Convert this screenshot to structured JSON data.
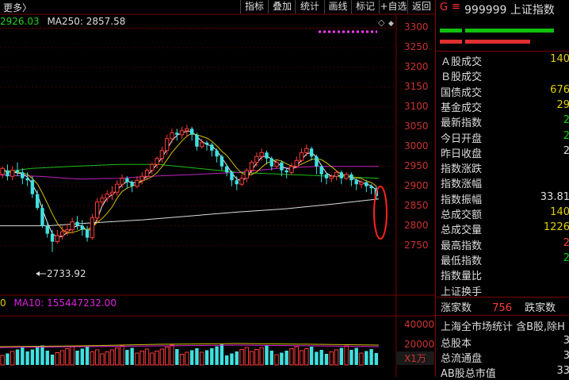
{
  "toolbar": {
    "more_label": "更多〉",
    "buttons": [
      "指标",
      "叠加",
      "统计",
      "画线",
      "标记",
      "+自选",
      "返回"
    ]
  },
  "ma_legend": {
    "ma_prev": "2926.03",
    "ma250": "MA250: 2857.58"
  },
  "y_axis": [
    "3300",
    "3250",
    "3200",
    "3150",
    "3100",
    "3050",
    "3000",
    "2950",
    "2900",
    "2850",
    "2800",
    "2750"
  ],
  "low_label": "2733.92",
  "volume": {
    "legend_prefix": "0",
    "legend_ma10": "MA10: 155447232.00",
    "ticks": [
      "40000",
      "20000"
    ],
    "unit": "X1万"
  },
  "header": {
    "badge_g": "G",
    "menu_icon": "≡",
    "code": "999999",
    "name": "上证指数"
  },
  "stats": [
    {
      "label": "Ａ股成交",
      "value": "140",
      "color": "yel"
    },
    {
      "label": "Ｂ股成交",
      "value": "",
      "color": "yel"
    },
    {
      "label": "国债成交",
      "value": "676",
      "color": "yel"
    },
    {
      "label": "基金成交",
      "value": "29",
      "color": "yel"
    },
    {
      "label": "最新指数",
      "value": "2",
      "color": "grn"
    },
    {
      "label": "今日开盘",
      "value": "2",
      "color": "grn"
    },
    {
      "label": "昨日收盘",
      "value": "2",
      "color": "white"
    },
    {
      "label": "指数涨跌",
      "value": "",
      "color": "grn"
    },
    {
      "label": "指数涨幅",
      "value": "",
      "color": "grn"
    },
    {
      "label": "指数振幅",
      "value": "33.81",
      "color": "white"
    },
    {
      "label": "总成交额",
      "value": "140",
      "color": "yel"
    },
    {
      "label": "总成交量",
      "value": "1226",
      "color": "yel"
    },
    {
      "label": "最高指数",
      "value": "2",
      "color": "red"
    },
    {
      "label": "最低指数",
      "value": "2",
      "color": "grn"
    },
    {
      "label": "指数量比",
      "value": "",
      "color": "white"
    },
    {
      "label": "上证换手",
      "value": "",
      "color": "white"
    }
  ],
  "updown": {
    "up_label": "涨家数",
    "up_value": "756",
    "down_label": "跌家数"
  },
  "market": {
    "title": "上海全市场统计 含B股,除H",
    "rows": [
      {
        "label": "总股本",
        "value": "3"
      },
      {
        "label": "总流通盘",
        "value": "3"
      },
      {
        "label": "AB股总市值",
        "value": "33"
      }
    ]
  },
  "chart_data": {
    "type": "candlestick",
    "y_range": [
      2725,
      3320
    ],
    "y_ticks": [
      3300,
      3250,
      3200,
      3150,
      3100,
      3050,
      3000,
      2950,
      2900,
      2850,
      2800,
      2750
    ],
    "candles": [
      [
        2930,
        2945,
        2920,
        2950
      ],
      [
        2940,
        2925,
        2915,
        2955
      ],
      [
        2925,
        2940,
        2915,
        2950
      ],
      [
        2940,
        2935,
        2925,
        2960
      ],
      [
        2935,
        2920,
        2905,
        2945
      ],
      [
        2920,
        2915,
        2900,
        2935
      ],
      [
        2915,
        2880,
        2870,
        2925
      ],
      [
        2880,
        2845,
        2840,
        2890
      ],
      [
        2845,
        2800,
        2795,
        2855
      ],
      [
        2800,
        2780,
        2770,
        2810
      ],
      [
        2780,
        2760,
        2734,
        2790
      ],
      [
        2760,
        2775,
        2755,
        2790
      ],
      [
        2775,
        2785,
        2765,
        2800
      ],
      [
        2785,
        2790,
        2775,
        2805
      ],
      [
        2790,
        2810,
        2780,
        2820
      ],
      [
        2810,
        2800,
        2790,
        2825
      ],
      [
        2800,
        2790,
        2775,
        2815
      ],
      [
        2790,
        2770,
        2760,
        2800
      ],
      [
        2770,
        2820,
        2765,
        2830
      ],
      [
        2820,
        2860,
        2810,
        2870
      ],
      [
        2860,
        2870,
        2850,
        2880
      ],
      [
        2870,
        2880,
        2860,
        2890
      ],
      [
        2880,
        2885,
        2865,
        2900
      ],
      [
        2885,
        2905,
        2875,
        2915
      ],
      [
        2905,
        2920,
        2895,
        2930
      ],
      [
        2920,
        2910,
        2895,
        2925
      ],
      [
        2910,
        2900,
        2885,
        2915
      ],
      [
        2900,
        2915,
        2895,
        2925
      ],
      [
        2915,
        2925,
        2905,
        2935
      ],
      [
        2925,
        2940,
        2915,
        2945
      ],
      [
        2940,
        2955,
        2930,
        2960
      ],
      [
        2955,
        2970,
        2945,
        2975
      ],
      [
        2970,
        2990,
        2960,
        3000
      ],
      [
        2990,
        3020,
        2980,
        3030
      ],
      [
        3020,
        3035,
        3010,
        3045
      ],
      [
        3035,
        3030,
        3015,
        3045
      ],
      [
        3030,
        3040,
        3020,
        3050
      ],
      [
        3040,
        3045,
        3025,
        3055
      ],
      [
        3045,
        3030,
        3015,
        3050
      ],
      [
        3030,
        3000,
        2990,
        3035
      ],
      [
        3000,
        3010,
        2995,
        3020
      ],
      [
        3010,
        3005,
        2990,
        3015
      ],
      [
        3005,
        2990,
        2975,
        3010
      ],
      [
        2990,
        2975,
        2960,
        2995
      ],
      [
        2975,
        2950,
        2940,
        2980
      ],
      [
        2950,
        2935,
        2925,
        2955
      ],
      [
        2935,
        2915,
        2900,
        2940
      ],
      [
        2915,
        2905,
        2890,
        2925
      ],
      [
        2905,
        2920,
        2900,
        2930
      ],
      [
        2920,
        2940,
        2910,
        2945
      ],
      [
        2940,
        2960,
        2930,
        2965
      ],
      [
        2960,
        2975,
        2950,
        2985
      ],
      [
        2975,
        2985,
        2965,
        2995
      ],
      [
        2985,
        2970,
        2955,
        2990
      ],
      [
        2970,
        2950,
        2940,
        2975
      ],
      [
        2950,
        2960,
        2945,
        2965
      ],
      [
        2960,
        2940,
        2925,
        2965
      ],
      [
        2940,
        2935,
        2920,
        2945
      ],
      [
        2935,
        2950,
        2930,
        2960
      ],
      [
        2950,
        2965,
        2945,
        2975
      ],
      [
        2965,
        2985,
        2960,
        2995
      ],
      [
        2985,
        2995,
        2975,
        3005
      ],
      [
        2995,
        2975,
        2965,
        3000
      ],
      [
        2975,
        2950,
        2930,
        2980
      ],
      [
        2950,
        2930,
        2910,
        2955
      ],
      [
        2930,
        2920,
        2905,
        2935
      ],
      [
        2920,
        2925,
        2910,
        2930
      ],
      [
        2925,
        2935,
        2915,
        2940
      ],
      [
        2935,
        2920,
        2905,
        2940
      ],
      [
        2920,
        2930,
        2915,
        2935
      ],
      [
        2930,
        2915,
        2900,
        2935
      ],
      [
        2915,
        2905,
        2890,
        2920
      ],
      [
        2905,
        2910,
        2895,
        2915
      ],
      [
        2910,
        2900,
        2885,
        2915
      ],
      [
        2900,
        2895,
        2880,
        2905
      ],
      [
        2895,
        2875,
        2865,
        2900
      ]
    ],
    "ma250": [
      [
        0,
        2800
      ],
      [
        60,
        2800
      ],
      [
        120,
        2808
      ],
      [
        180,
        2815
      ],
      [
        240,
        2825
      ],
      [
        300,
        2835
      ],
      [
        360,
        2843
      ],
      [
        420,
        2855
      ],
      [
        478,
        2868
      ]
    ],
    "ma_green": [
      [
        0,
        2935
      ],
      [
        40,
        2945
      ],
      [
        90,
        2950
      ],
      [
        150,
        2955
      ],
      [
        200,
        2955
      ],
      [
        250,
        2945
      ],
      [
        300,
        2935
      ],
      [
        360,
        2930
      ],
      [
        420,
        2925
      ],
      [
        478,
        2920
      ]
    ],
    "ma_magenta": [
      [
        0,
        2928
      ],
      [
        50,
        2925
      ],
      [
        100,
        2918
      ],
      [
        150,
        2920
      ],
      [
        200,
        2926
      ],
      [
        250,
        2930
      ],
      [
        300,
        2935
      ],
      [
        350,
        2945
      ],
      [
        400,
        2950
      ],
      [
        440,
        2950
      ],
      [
        478,
        2950
      ]
    ]
  }
}
